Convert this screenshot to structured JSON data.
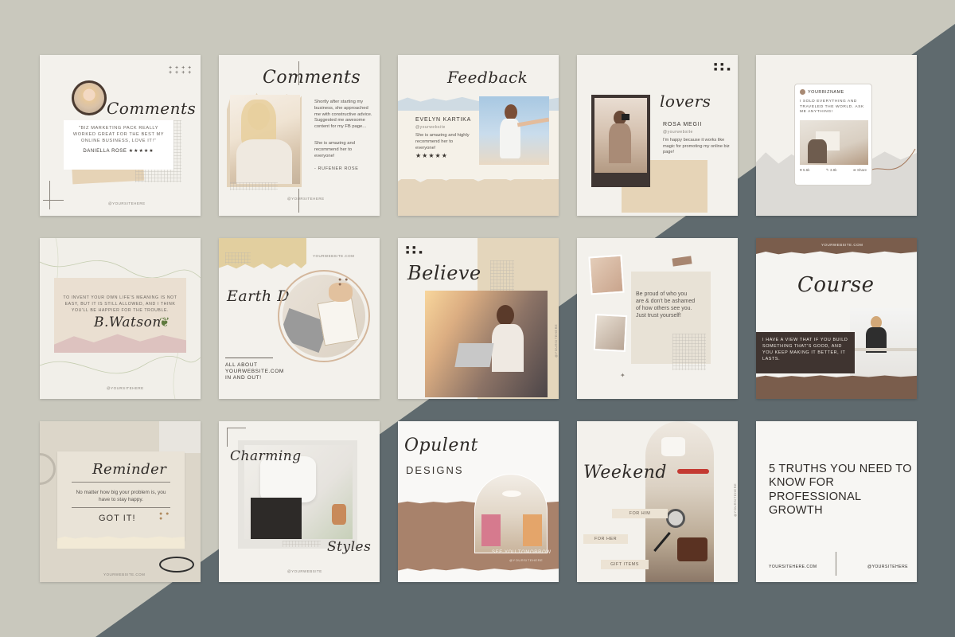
{
  "colors": {
    "bg_light": "#c9c8bd",
    "bg_dark": "#5f6a6e",
    "card": "#f3f1ec",
    "brown": "#8b6a55",
    "dark_brown": "#3b3330",
    "tan": "#d9c8ad"
  },
  "cards": {
    "c1": {
      "title": "Comments",
      "quote": "\"BIZ MARKETING PACK REALLY WORKED GREAT FOR THE BEST MY ONLINE BUSINESS, LOVE IT!\"",
      "name": "DANIELLA ROSE",
      "stars": "★★★★★",
      "site": "@YOURSITEHERE"
    },
    "c2": {
      "title": "Comments",
      "body": "Shortly after starting my business, she approached me with constructive advice. Suggested me awesome content for my FB page...",
      "body2": "She is amazing and recommend her to everyone!",
      "sig": "- RUFENER ROSE",
      "site": "@YOURSITEHERE"
    },
    "c3": {
      "title": "Feedback",
      "name": "EVELYN KARTIKA",
      "handle": "@yourwebsite",
      "body": "She is amazing and highly recommend her to everyone!",
      "stars": "★★★★★"
    },
    "c4": {
      "title": "lovers",
      "name": "ROSA MEGII",
      "handle": "@yourwebsite",
      "body": "I'm happy because it works like magic for promoting my online biz page!"
    },
    "c5": {
      "bizname": "YOURBIZNAME",
      "body": "I SOLD EVERYTHING AND TRAVELED THE WORLD. ASK ME ANYTHING!",
      "likes": "5.6k",
      "comments": "3.9k",
      "share": "Share"
    },
    "c6": {
      "quote": "TO INVENT YOUR OWN LIFE'S MEANING IS NOT EASY, BUT IT IS STILL ALLOWED, AND I THINK YOU'LL BE HAPPIER FOR THE TROUBLE.",
      "sig": "B.Watson",
      "site": "@YOURSITEHERE"
    },
    "c7": {
      "site_top": "YOURWEBSITE.COM",
      "title": "Earth Day",
      "line1": "ALL ABOUT",
      "line2": "YOURWEBSITE.COM",
      "line3": "IN AND OUT!"
    },
    "c8": {
      "title": "Believe",
      "side": "@YOURSITEHERE"
    },
    "c9": {
      "body": "Be proud of who you are & don't be ashamed of how others see you. Just trust yourself!"
    },
    "c10": {
      "site_top": "YOURWEBSITE.COM",
      "title": "Course",
      "body": "I HAVE A VIEW THAT IF YOU BUILD SOMETHING THAT'S GOOD, AND YOU KEEP MAKING IT BETTER, IT LASTS."
    },
    "c11": {
      "title": "Reminder",
      "body": "No matter how big your problem is, you have to stay happy.",
      "cta": "GOT IT!",
      "site": "YOURWEBSITE.COM"
    },
    "c12": {
      "title": "Charming",
      "title2": "Styles",
      "site": "@YOURWEBSITE"
    },
    "c13": {
      "title": "Opulent",
      "subtitle": "DESIGNS",
      "cta": "SEE YOU TOMORROW",
      "handle": "@YOURSITEHERE"
    },
    "c14": {
      "title": "Weekend",
      "for_him": "FOR HIM",
      "for_her": "FOR HER",
      "gift": "GIFT ITEMS",
      "side": "@YOURSITEHERE"
    },
    "c15": {
      "headline": "5 TRUTHS YOU NEED TO KNOW FOR PROFESSIONAL GROWTH",
      "site": "YOURSITEHERE.COM",
      "handle": "@YOURSITEHERE"
    }
  }
}
